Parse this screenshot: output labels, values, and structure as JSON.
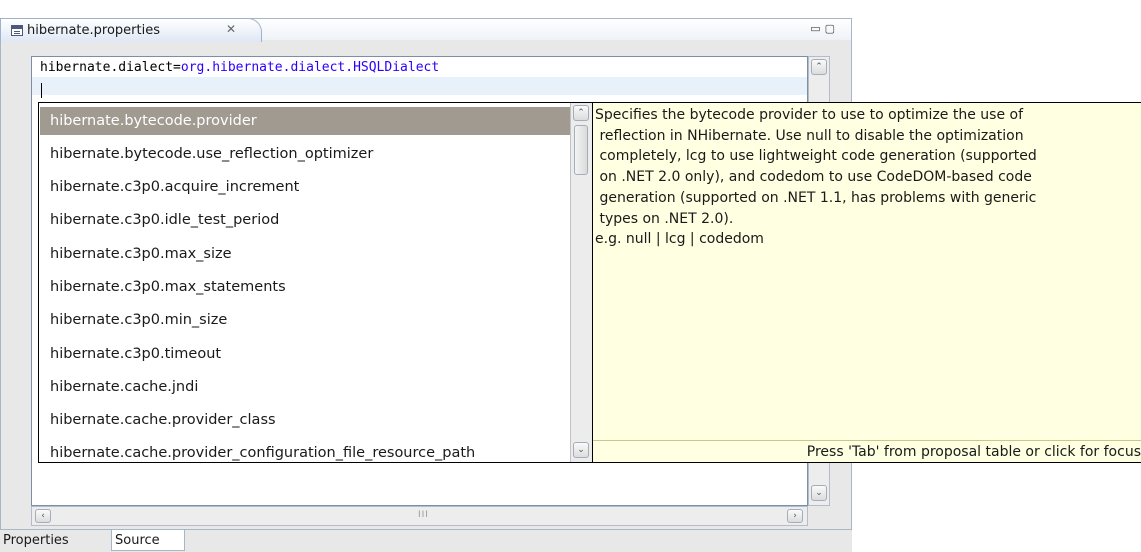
{
  "window": {
    "tab_title": "hibernate.properties",
    "tab_close_glyph": "✕",
    "window_buttons": "▭▢"
  },
  "editor": {
    "line_key": "hibernate.dialect=",
    "line_value": "org.hibernate.dialect.HSQLDialect"
  },
  "proposals": {
    "selected_index": 0,
    "items": [
      "hibernate.bytecode.provider",
      "hibernate.bytecode.use_reflection_optimizer",
      "hibernate.c3p0.acquire_increment",
      "hibernate.c3p0.idle_test_period",
      "hibernate.c3p0.max_size",
      "hibernate.c3p0.max_statements",
      "hibernate.c3p0.min_size",
      "hibernate.c3p0.timeout",
      "hibernate.cache.jndi",
      "hibernate.cache.provider_class",
      "hibernate.cache.provider_configuration_file_resource_path"
    ]
  },
  "info": {
    "description": "Specifies the bytecode provider to use to optimize the use of\n reflection in NHibernate. Use null to disable the optimization\n completely, lcg to use lightweight code generation (supported\n on .NET 2.0 only), and codedom to use CodeDOM-based code\n generation (supported on .NET 1.1, has problems with generic\n types on .NET 2.0).\ne.g. null | lcg | codedom",
    "footer": "Press 'Tab' from proposal table or click for focus"
  },
  "bottom_tabs": {
    "properties": "Properties",
    "source": "Source"
  },
  "scrollbar": {
    "up": "⌃",
    "down": "⌄",
    "left": "‹",
    "right": "›",
    "grip": "III"
  },
  "colors": {
    "selection": "#a09a90",
    "info_background": "#ffffe1",
    "value_text": "#2a00ff",
    "current_line": "#e8f0fa"
  }
}
